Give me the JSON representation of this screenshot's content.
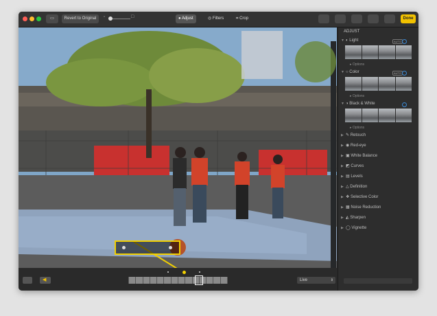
{
  "toolbar": {
    "revert_label": "Revert to Original",
    "tabs": [
      "Adjust",
      "Filters",
      "Crop"
    ],
    "done_label": "Done"
  },
  "sidebar": {
    "title": "ADJUST",
    "items": [
      {
        "label": "Light",
        "options": "Options",
        "auto": "AUTO"
      },
      {
        "label": "Color",
        "options": "Options",
        "auto": "AUTO"
      },
      {
        "label": "Black & White",
        "options": "Options"
      },
      {
        "label": "Retouch"
      },
      {
        "label": "Red-eye"
      },
      {
        "label": "White Balance"
      },
      {
        "label": "Curves"
      },
      {
        "label": "Levels"
      },
      {
        "label": "Definition"
      },
      {
        "label": "Selective Color"
      },
      {
        "label": "Noise Reduction"
      },
      {
        "label": "Sharpen"
      },
      {
        "label": "Vignette"
      }
    ]
  },
  "bottom": {
    "live_label": "Live"
  },
  "colors": {
    "accent": "#f2c200",
    "callout": "#f2d000",
    "selection": "#3b8ad8"
  }
}
